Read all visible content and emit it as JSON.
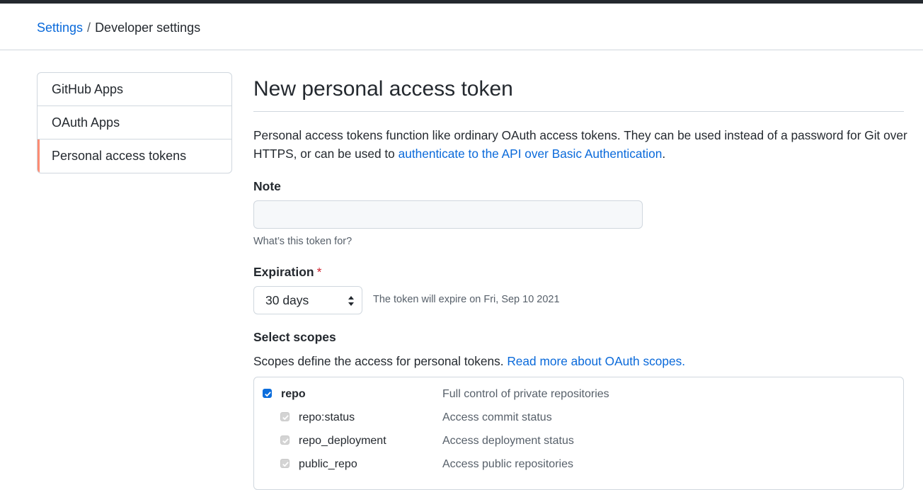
{
  "breadcrumb": {
    "root": "Settings",
    "current": "Developer settings"
  },
  "sidebar": {
    "items": [
      {
        "label": "GitHub Apps"
      },
      {
        "label": "OAuth Apps"
      },
      {
        "label": "Personal access tokens",
        "selected": true
      }
    ]
  },
  "main": {
    "title": "New personal access token",
    "intro_text": "Personal access tokens function like ordinary OAuth access tokens. They can be used instead of a password for Git over HTTPS, or can be used to ",
    "intro_link": "authenticate to the API over Basic Authentication",
    "intro_end": ".",
    "note": {
      "label": "Note",
      "value": "",
      "placeholder": "",
      "hint": "What’s this token for?"
    },
    "expiration": {
      "label": "Expiration",
      "required_mark": "*",
      "selected": "30 days",
      "note": "The token will expire on Fri, Sep 10 2021"
    },
    "scopes": {
      "label": "Select scopes",
      "desc": "Scopes define the access for personal tokens. ",
      "link": "Read more about OAuth scopes.",
      "items": [
        {
          "name": "repo",
          "desc": "Full control of private repositories",
          "checked": true,
          "disabled": false
        },
        {
          "name": "repo:status",
          "desc": "Access commit status",
          "checked": true,
          "disabled": true
        },
        {
          "name": "repo_deployment",
          "desc": "Access deployment status",
          "checked": true,
          "disabled": true
        },
        {
          "name": "public_repo",
          "desc": "Access public repositories",
          "checked": true,
          "disabled": true
        }
      ]
    }
  },
  "colors": {
    "accent": "#0969da",
    "selected_marker": "#fd8c73",
    "required": "#cf222e"
  }
}
